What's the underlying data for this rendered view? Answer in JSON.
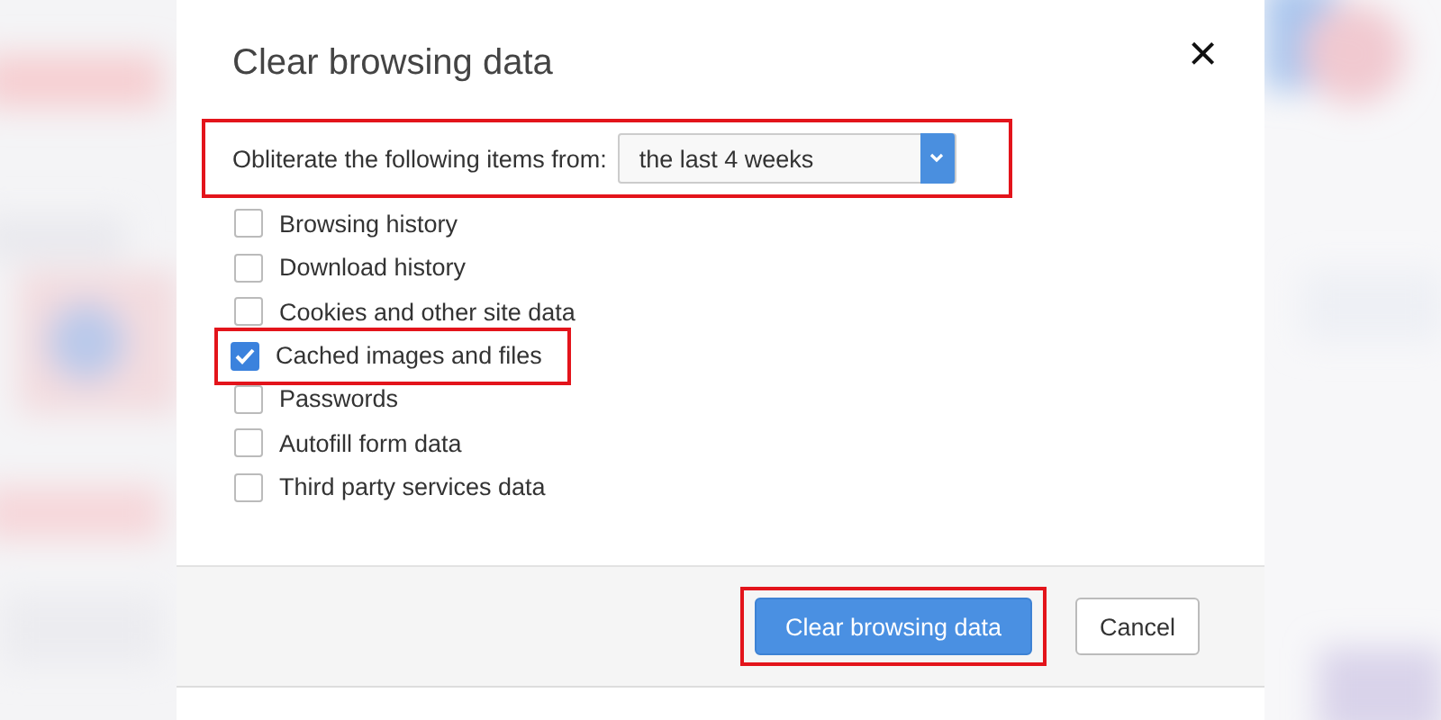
{
  "dialog": {
    "title": "Clear browsing data",
    "close": "×"
  },
  "range": {
    "label": "Obliterate the following items from:",
    "value": "the last 4 weeks",
    "highlighted": true
  },
  "items": [
    {
      "label": "Browsing history",
      "checked": false,
      "highlighted": false
    },
    {
      "label": "Download history",
      "checked": false,
      "highlighted": false
    },
    {
      "label": "Cookies and other site data",
      "checked": false,
      "highlighted": false
    },
    {
      "label": "Cached images and files",
      "checked": true,
      "highlighted": true
    },
    {
      "label": "Passwords",
      "checked": false,
      "highlighted": false
    },
    {
      "label": "Autofill form data",
      "checked": false,
      "highlighted": false
    },
    {
      "label": "Third party services data",
      "checked": false,
      "highlighted": false
    }
  ],
  "buttons": [
    {
      "label": "Clear browsing data",
      "kind": "primary",
      "highlighted": true
    },
    {
      "label": "Cancel",
      "kind": "secondary",
      "highlighted": false
    }
  ]
}
